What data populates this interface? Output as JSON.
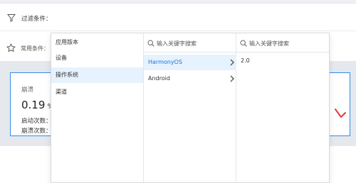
{
  "filter": {
    "label": "过滤条件：",
    "icon": "filter-icon"
  },
  "common": {
    "label": "常用条件：",
    "icon": "star-icon"
  },
  "card": {
    "title": "崩溃",
    "rate_value": "0.19",
    "rate_unit": " %",
    "launch_label": "启动次数：",
    "crash_label": "崩溃次数："
  },
  "dropdown": {
    "dimensions": [
      {
        "label": "应用版本"
      },
      {
        "label": "设备"
      },
      {
        "label": "操作系统",
        "selected": true
      },
      {
        "label": "渠道"
      }
    ],
    "os_panel": {
      "search_placeholder": "输入关键字搜索",
      "options": [
        {
          "label": "HarmonyOS",
          "selected": true
        },
        {
          "label": "Android",
          "selected": false
        }
      ]
    },
    "version_panel": {
      "search_placeholder": "输入关键字搜索",
      "options": [
        {
          "label": "2.0"
        }
      ]
    }
  },
  "colors": {
    "accent": "#1677d8",
    "card_border": "#2f8df0",
    "selected_bg": "#e6f2fd",
    "alert_red": "#e23b3b"
  }
}
